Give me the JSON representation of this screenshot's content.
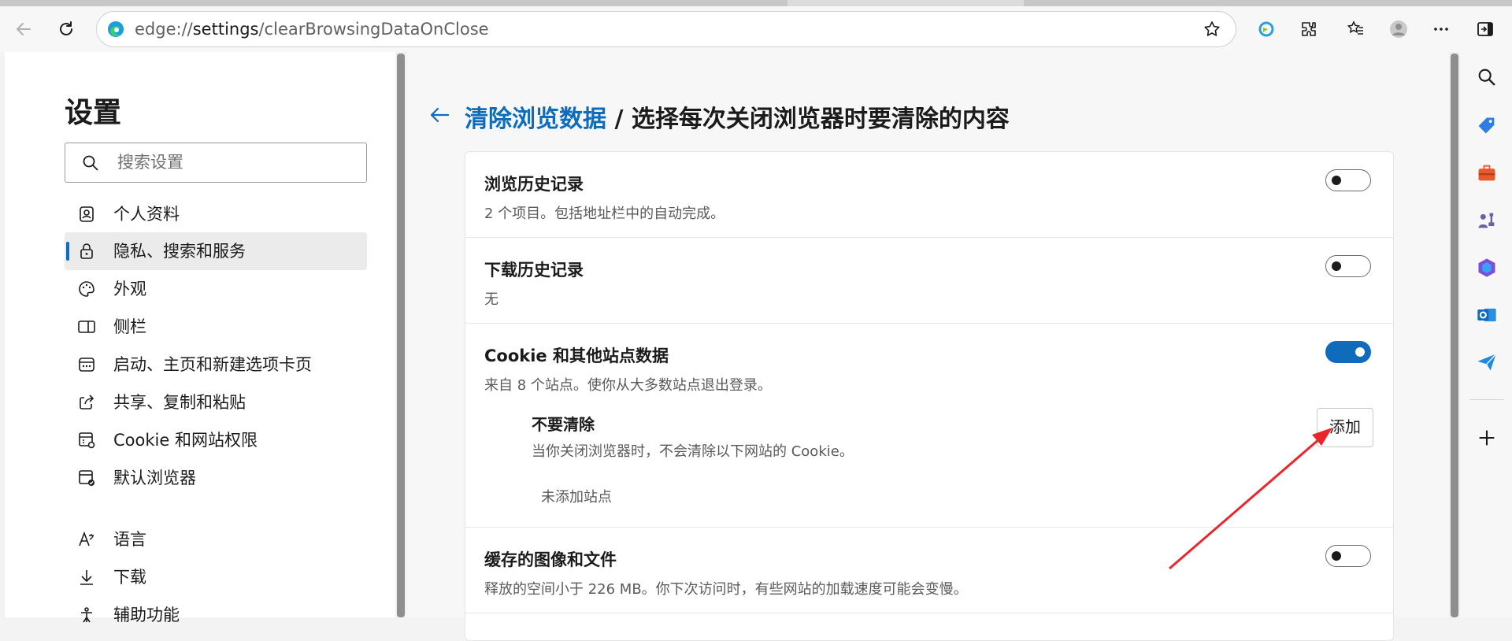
{
  "browser": {
    "url_scheme": "edge://",
    "url_host": "settings",
    "url_path": "/clearBrowsingDataOnClose"
  },
  "sidebar": {
    "title": "设置",
    "search_placeholder": "搜索设置",
    "items": [
      {
        "label": "个人资料",
        "icon": "profile-icon"
      },
      {
        "label": "隐私、搜索和服务",
        "icon": "lock-icon",
        "active": true
      },
      {
        "label": "外观",
        "icon": "palette-icon"
      },
      {
        "label": "侧栏",
        "icon": "sidebar-icon"
      },
      {
        "label": "启动、主页和新建选项卡页",
        "icon": "startup-icon"
      },
      {
        "label": "共享、复制和粘贴",
        "icon": "share-icon"
      },
      {
        "label": "Cookie 和网站权限",
        "icon": "site-permissions-icon"
      },
      {
        "label": "默认浏览器",
        "icon": "default-browser-icon"
      },
      {
        "label": "语言",
        "icon": "language-icon"
      },
      {
        "label": "下载",
        "icon": "download-icon"
      },
      {
        "label": "辅助功能",
        "icon": "accessibility-icon"
      }
    ]
  },
  "main": {
    "breadcrumb_link": "清除浏览数据",
    "breadcrumb_rest": " / 选择每次关闭浏览器时要清除的内容",
    "rows": [
      {
        "title": "浏览历史记录",
        "desc": "2 个项目。包括地址栏中的自动完成。",
        "enabled": false
      },
      {
        "title": "下载历史记录",
        "desc": "无",
        "enabled": false
      },
      {
        "title": "Cookie 和其他站点数据",
        "desc": "来自 8 个站点。使你从大多数站点退出登录。",
        "enabled": true
      },
      {
        "title": "缓存的图像和文件",
        "desc": "释放的空间小于 226 MB。你下次访问时，有些网站的加载速度可能会变慢。",
        "enabled": false
      }
    ],
    "dont_clear": {
      "title": "不要清除",
      "desc": "当你关闭浏览器时，不会清除以下网站的 Cookie。",
      "add_label": "添加",
      "empty_text": "未添加站点"
    }
  },
  "colors": {
    "accent": "#0f6cbd",
    "annotation": "#e8262b"
  }
}
